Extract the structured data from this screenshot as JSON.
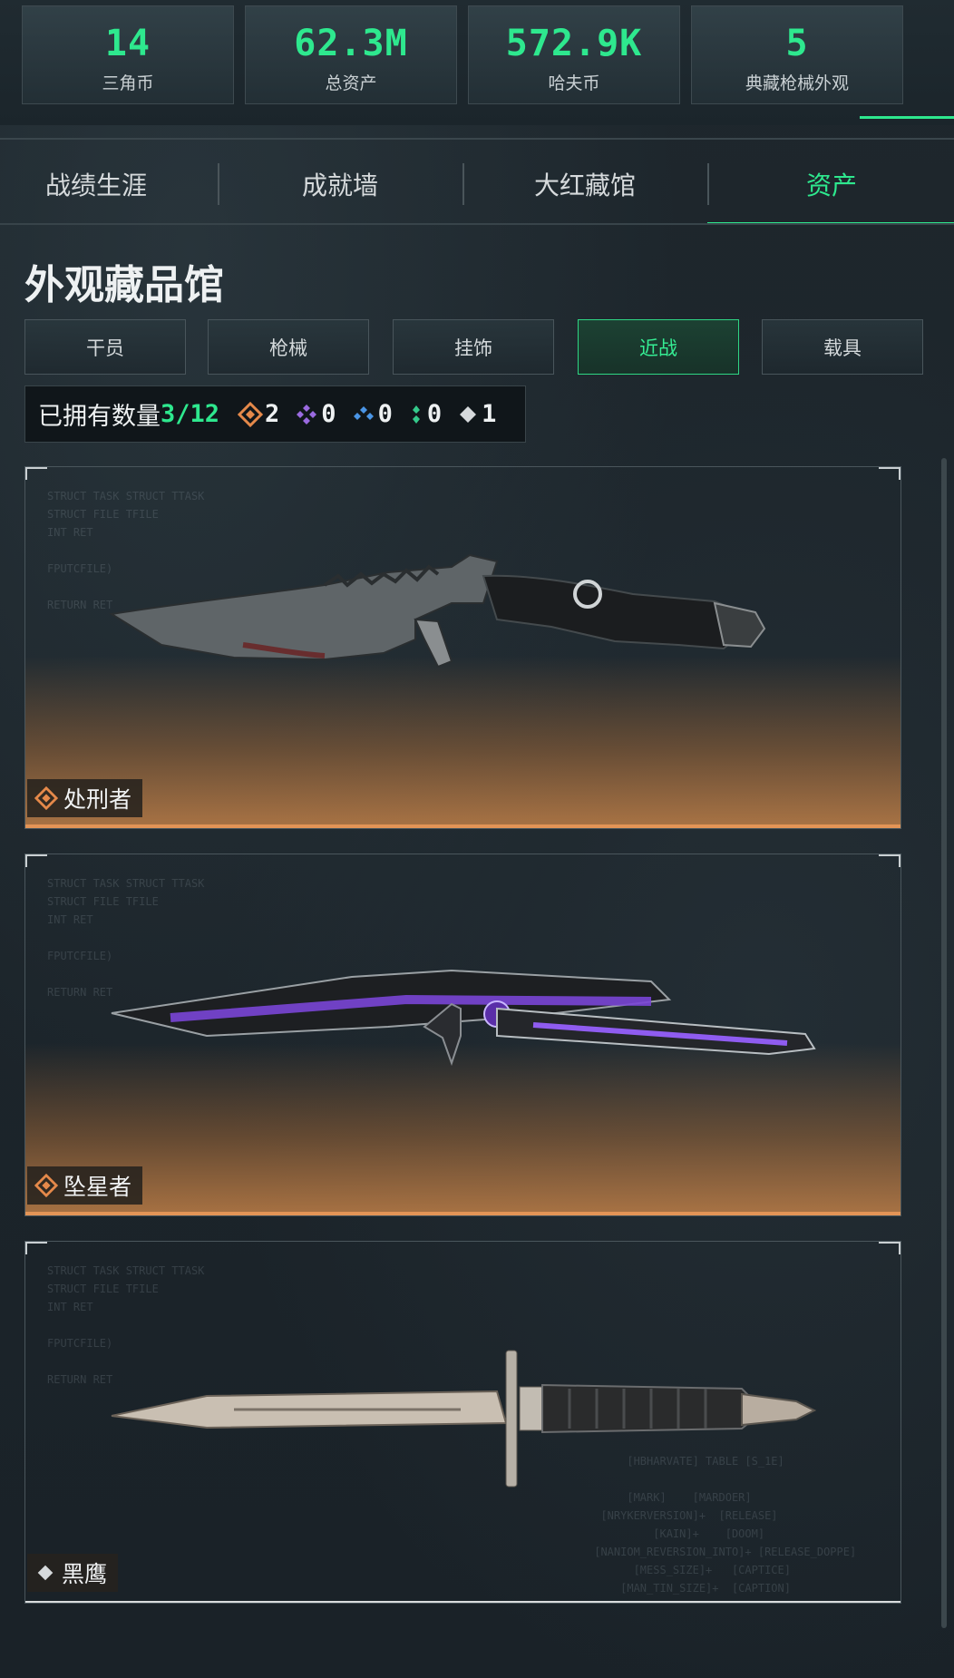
{
  "stats": [
    {
      "value": "14",
      "label": "三角币"
    },
    {
      "value": "62.3M",
      "label": "总资产"
    },
    {
      "value": "572.9K",
      "label": "哈夫币"
    },
    {
      "value": "5",
      "label": "典藏枪械外观"
    }
  ],
  "tabs": [
    {
      "label": "战绩生涯",
      "active": false
    },
    {
      "label": "成就墙",
      "active": false
    },
    {
      "label": "大红藏馆",
      "active": false
    },
    {
      "label": "资产",
      "active": true
    }
  ],
  "section": {
    "title": "外观藏品馆"
  },
  "filters": [
    {
      "label": "干员",
      "active": false
    },
    {
      "label": "枪械",
      "active": false
    },
    {
      "label": "挂饰",
      "active": false
    },
    {
      "label": "近战",
      "active": true
    },
    {
      "label": "载具",
      "active": false
    }
  ],
  "owned": {
    "label": "已拥有数量",
    "count": "3/12",
    "rarities": [
      {
        "icon": "orange-diamond-icon",
        "color": "#e5894a",
        "count": "2"
      },
      {
        "icon": "purple-diamond-icon",
        "color": "#9a6ae0",
        "count": "0"
      },
      {
        "icon": "blue-diamond-icon",
        "color": "#4a95e6",
        "count": "0"
      },
      {
        "icon": "green-diamond-icon",
        "color": "#34c98a",
        "count": "0"
      },
      {
        "icon": "white-diamond-icon",
        "color": "#d6dadc",
        "count": "1"
      }
    ]
  },
  "items": [
    {
      "name": "处刑者",
      "rarity": "orange",
      "icon": "orange-diamond-icon",
      "color": "#e5894a"
    },
    {
      "name": "坠星者",
      "rarity": "orange",
      "icon": "orange-diamond-icon",
      "color": "#e5894a"
    },
    {
      "name": "黑鹰",
      "rarity": "white",
      "icon": "white-diamond-icon",
      "color": "#d6dadc"
    }
  ],
  "colors": {
    "accent": "#2ee88e",
    "orange": "#e39456"
  }
}
